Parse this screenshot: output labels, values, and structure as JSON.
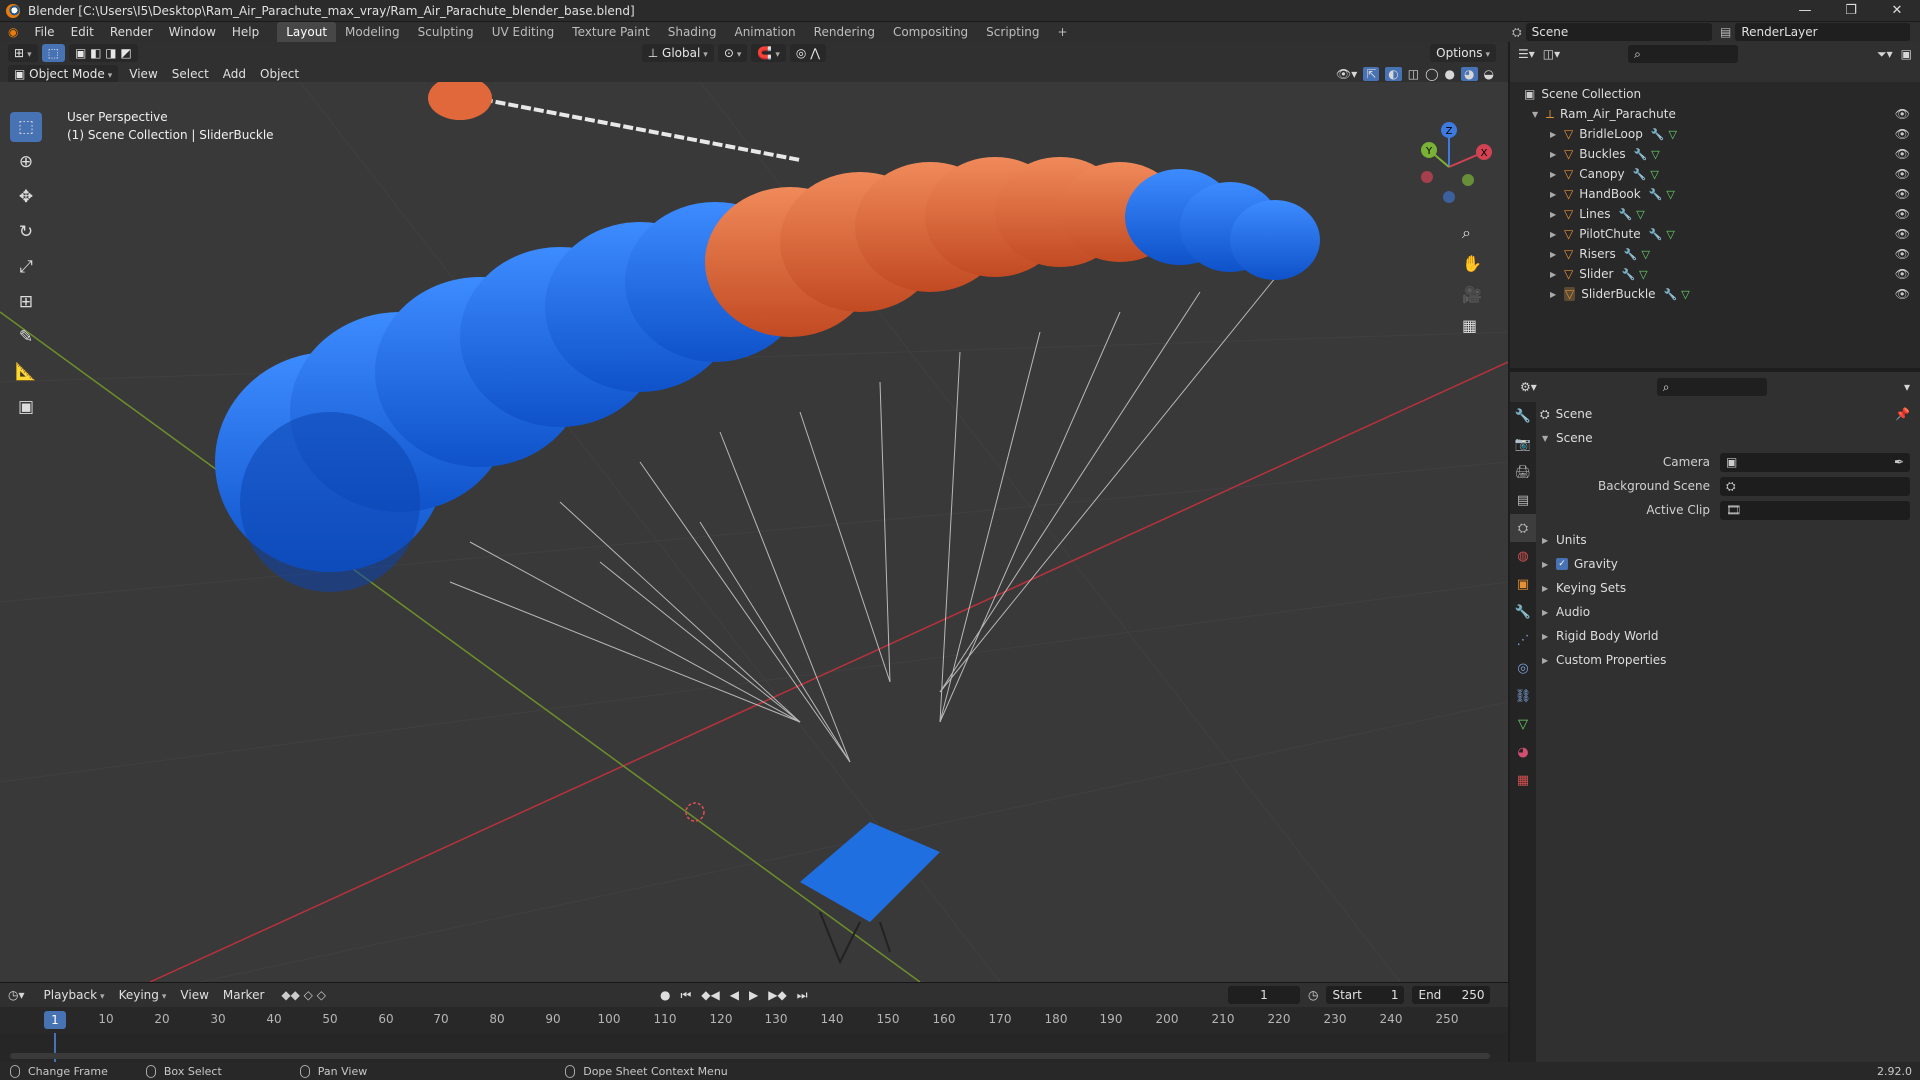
{
  "window": {
    "title": "Blender [C:\\Users\\I5\\Desktop\\Ram_Air_Parachute_max_vray/Ram_Air_Parachute_blender_base.blend]",
    "buttons": [
      "—",
      "❐",
      "✕"
    ]
  },
  "menu": [
    "File",
    "Edit",
    "Render",
    "Window",
    "Help"
  ],
  "workspaces": [
    {
      "label": "Layout",
      "active": true
    },
    {
      "label": "Modeling"
    },
    {
      "label": "Sculpting"
    },
    {
      "label": "UV Editing"
    },
    {
      "label": "Texture Paint"
    },
    {
      "label": "Shading"
    },
    {
      "label": "Animation"
    },
    {
      "label": "Rendering"
    },
    {
      "label": "Compositing"
    },
    {
      "label": "Scripting"
    }
  ],
  "topbar_right": {
    "scene": "Scene",
    "view_layer": "RenderLayer"
  },
  "viewport_header": {
    "transform_orientation": "Global",
    "options_label": "Options",
    "mode": "Object Mode",
    "menus": [
      "View",
      "Select",
      "Add",
      "Object"
    ]
  },
  "viewport_overlay": {
    "line1": "User Perspective",
    "line2": "(1) Scene Collection | SliderBuckle"
  },
  "gizmo_axes": {
    "x": "X",
    "y": "Y",
    "z": "Z"
  },
  "timeline": {
    "menus": [
      "Playback",
      "Keying",
      "View",
      "Marker"
    ],
    "current_frame": "1",
    "start_label": "Start",
    "start": "1",
    "end_label": "End",
    "end": "250",
    "ticks": [
      "10",
      "20",
      "30",
      "40",
      "50",
      "60",
      "70",
      "80",
      "90",
      "100",
      "110",
      "120",
      "130",
      "140",
      "150",
      "160",
      "170",
      "180",
      "190",
      "200",
      "210",
      "220",
      "230",
      "240",
      "250"
    ],
    "cursor_label": "1"
  },
  "statusbar": {
    "items": [
      "Change Frame",
      "Box Select",
      "Pan View",
      "Dope Sheet Context Menu"
    ],
    "version": "2.92.0"
  },
  "outliner": {
    "root": "Scene Collection",
    "collection": "Ram_Air_Parachute",
    "objects": [
      "BridleLoop",
      "Buckles",
      "Canopy",
      "HandBook",
      "Lines",
      "PilotChute",
      "Risers",
      "Slider",
      "SliderBuckle"
    ]
  },
  "properties": {
    "context_title": "Scene",
    "panel_title": "Scene",
    "fields": [
      {
        "label": "Camera"
      },
      {
        "label": "Background Scene"
      },
      {
        "label": "Active Clip"
      }
    ],
    "subpanels": [
      {
        "label": "Units",
        "checkbox": false
      },
      {
        "label": "Gravity",
        "checkbox": true
      },
      {
        "label": "Keying Sets",
        "checkbox": false
      },
      {
        "label": "Audio",
        "checkbox": false
      },
      {
        "label": "Rigid Body World",
        "checkbox": false
      },
      {
        "label": "Custom Properties",
        "checkbox": false
      }
    ]
  },
  "colors": {
    "accent": "#4772b3",
    "canopy_blue": "#1f6fe0",
    "canopy_orange": "#e2673a",
    "object_orange": "#e49035"
  }
}
